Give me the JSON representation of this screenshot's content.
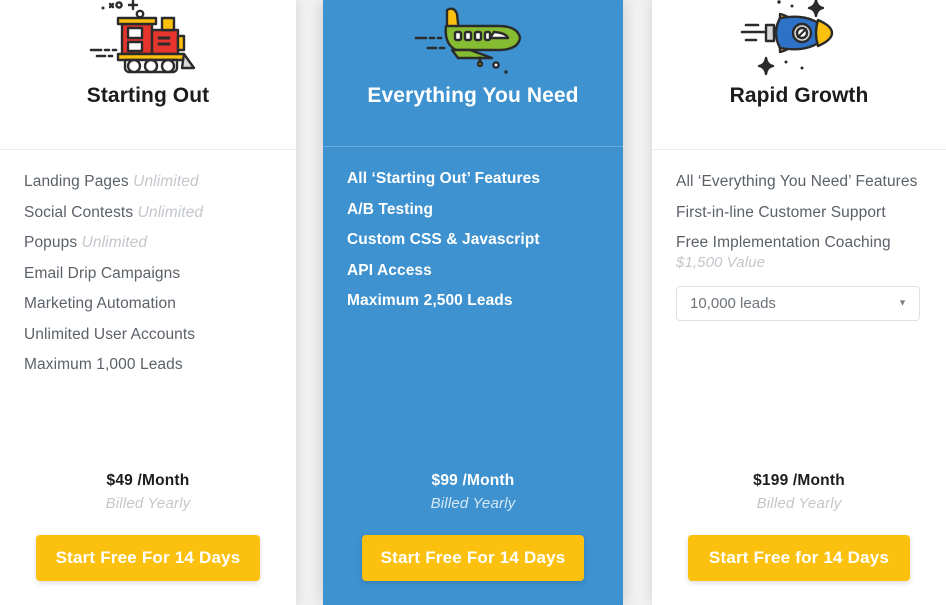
{
  "plans": [
    {
      "id": "starting-out",
      "icon": "train-icon",
      "title": "Starting Out",
      "features": [
        {
          "label": "Landing Pages",
          "value": "Unlimited"
        },
        {
          "label": "Social Contests",
          "value": "Unlimited"
        },
        {
          "label": "Popups",
          "value": "Unlimited"
        },
        {
          "label": "Email Drip Campaigns",
          "value": ""
        },
        {
          "label": "Marketing Automation",
          "value": ""
        },
        {
          "label": "Unlimited User Accounts",
          "value": ""
        },
        {
          "label": "Maximum 1,000 Leads",
          "value": ""
        }
      ],
      "price": "$49 /Month",
      "billing": "Billed Yearly",
      "cta": "Start Free For 14 Days"
    },
    {
      "id": "everything-you-need",
      "icon": "plane-icon",
      "title": "Everything You Need",
      "features": [
        {
          "label": "All ‘Starting Out’ Features",
          "value": ""
        },
        {
          "label": "A/B Testing",
          "value": ""
        },
        {
          "label": "Custom CSS & Javascript",
          "value": ""
        },
        {
          "label": "API Access",
          "value": ""
        },
        {
          "label": "Maximum 2,500 Leads",
          "value": ""
        }
      ],
      "price": "$99 /Month",
      "billing": "Billed Yearly",
      "cta": "Start Free For 14 Days"
    },
    {
      "id": "rapid-growth",
      "icon": "rocket-icon",
      "title": "Rapid Growth",
      "features": [
        {
          "label": "All ‘Everything You Need’ Features",
          "value": ""
        },
        {
          "label": "First-in-line Customer Support",
          "value": ""
        },
        {
          "label": "Free Implementation Coaching",
          "value": "",
          "note": "$1,500 Value"
        }
      ],
      "lead_select": {
        "selected": "10,000 leads",
        "caret": "▼"
      },
      "price": "$199 /Month",
      "billing": "Billed Yearly",
      "cta": "Start Free for 14 Days"
    }
  ],
  "colors": {
    "featured_background": "#3d92cf",
    "cta_background": "#fcc10f",
    "text_primary": "#1c1c1c",
    "text_secondary": "#5b6168",
    "text_muted": "#c3c7cb"
  }
}
